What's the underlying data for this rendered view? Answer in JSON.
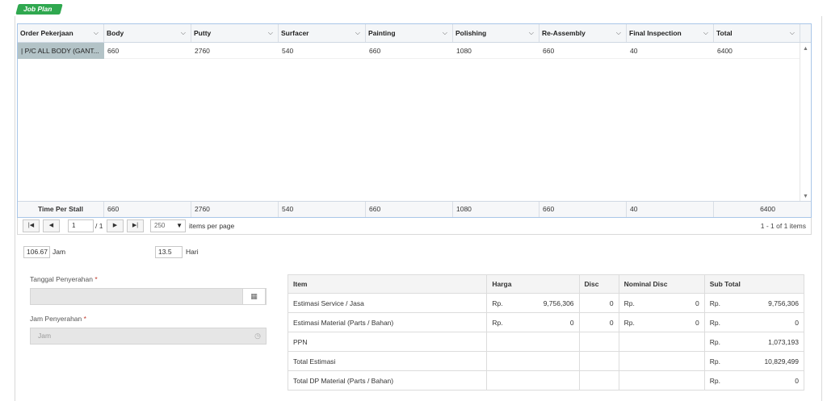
{
  "section_title": "Job Plan",
  "grid": {
    "columns": [
      {
        "key": "order",
        "label": "Order Pekerjaan"
      },
      {
        "key": "body",
        "label": "Body"
      },
      {
        "key": "putty",
        "label": "Putty"
      },
      {
        "key": "surfacer",
        "label": "Surfacer"
      },
      {
        "key": "painting",
        "label": "Painting"
      },
      {
        "key": "polishing",
        "label": "Polishing"
      },
      {
        "key": "reassembly",
        "label": "Re-Assembly"
      },
      {
        "key": "final",
        "label": "Final Inspection"
      },
      {
        "key": "total",
        "label": "Total"
      }
    ],
    "rows": [
      {
        "order": "| P/C ALL BODY (GANT...",
        "body": "660",
        "putty": "2760",
        "surfacer": "540",
        "painting": "660",
        "polishing": "1080",
        "reassembly": "660",
        "final": "40",
        "total": "6400"
      }
    ],
    "footer": {
      "label": "Time Per Stall",
      "body": "660",
      "putty": "2760",
      "surfacer": "540",
      "painting": "660",
      "polishing": "1080",
      "reassembly": "660",
      "final": "40",
      "total": "6400"
    }
  },
  "pager": {
    "first": "|◀",
    "prev": "◀",
    "next": "▶",
    "last": "▶|",
    "page": "1",
    "of": "/ 1",
    "page_size": "250",
    "items_per_page": "items per page",
    "info": "1 - 1 of 1 items"
  },
  "duration": {
    "jam_value": "106.67",
    "jam_label": "Jam",
    "hari_value": "13.5",
    "hari_label": "Hari"
  },
  "form": {
    "tanggal_label": "Tanggal Penyerahan",
    "jam_label": "Jam Penyerahan",
    "required_mark": "*",
    "jam_placeholder": "Jam"
  },
  "estimate": {
    "headers": {
      "item": "Item",
      "harga": "Harga",
      "disc": "Disc",
      "nominal": "Nominal Disc",
      "subtotal": "Sub Total"
    },
    "currency": "Rp.",
    "rows": [
      {
        "item": "Estimasi Service / Jasa",
        "harga": "9,756,306",
        "disc": "0",
        "nominal": "0",
        "subtotal": "9,756,306",
        "full": true
      },
      {
        "item": "Estimasi Material (Parts / Bahan)",
        "harga": "0",
        "disc": "0",
        "nominal": "0",
        "subtotal": "0",
        "full": true
      },
      {
        "item": "PPN",
        "subtotal": "1,073,193",
        "full": false
      },
      {
        "item": "Total Estimasi",
        "subtotal": "10,829,499",
        "full": false
      },
      {
        "item": "Total DP Material (Parts / Bahan)",
        "subtotal": "0",
        "full": false
      }
    ]
  }
}
